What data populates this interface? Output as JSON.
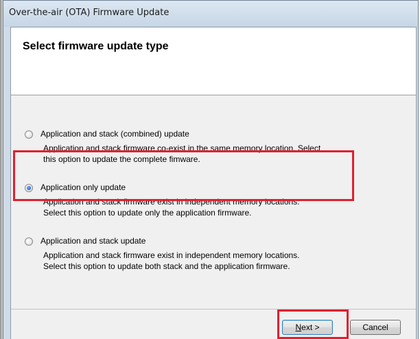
{
  "window": {
    "title": "Over-the-air (OTA) Firmware Update"
  },
  "header": {
    "title": "Select firmware update type"
  },
  "options": [
    {
      "label": "Application and stack (combined) update",
      "description_line1": "Application and stack firmware co-exist in the same memory location. Select",
      "description_line2": "this option to update the complete fimware.",
      "checked": false
    },
    {
      "label": "Application only update",
      "description_line1": "Application and stack firmware exist in independent memory locations.",
      "description_line2": "Select this option to update only the application firmware.",
      "checked": true
    },
    {
      "label": "Application and stack update",
      "description_line1": "Application and stack firmware exist in independent memory locations.",
      "description_line2": "Select this option to update both stack and the application firmware.",
      "checked": false
    }
  ],
  "footer": {
    "next_mnemonic": "N",
    "next_rest": "ext >",
    "cancel_label": "Cancel"
  },
  "colors": {
    "highlight": "#e0202e",
    "radio_selected": "#1d5fd0"
  }
}
